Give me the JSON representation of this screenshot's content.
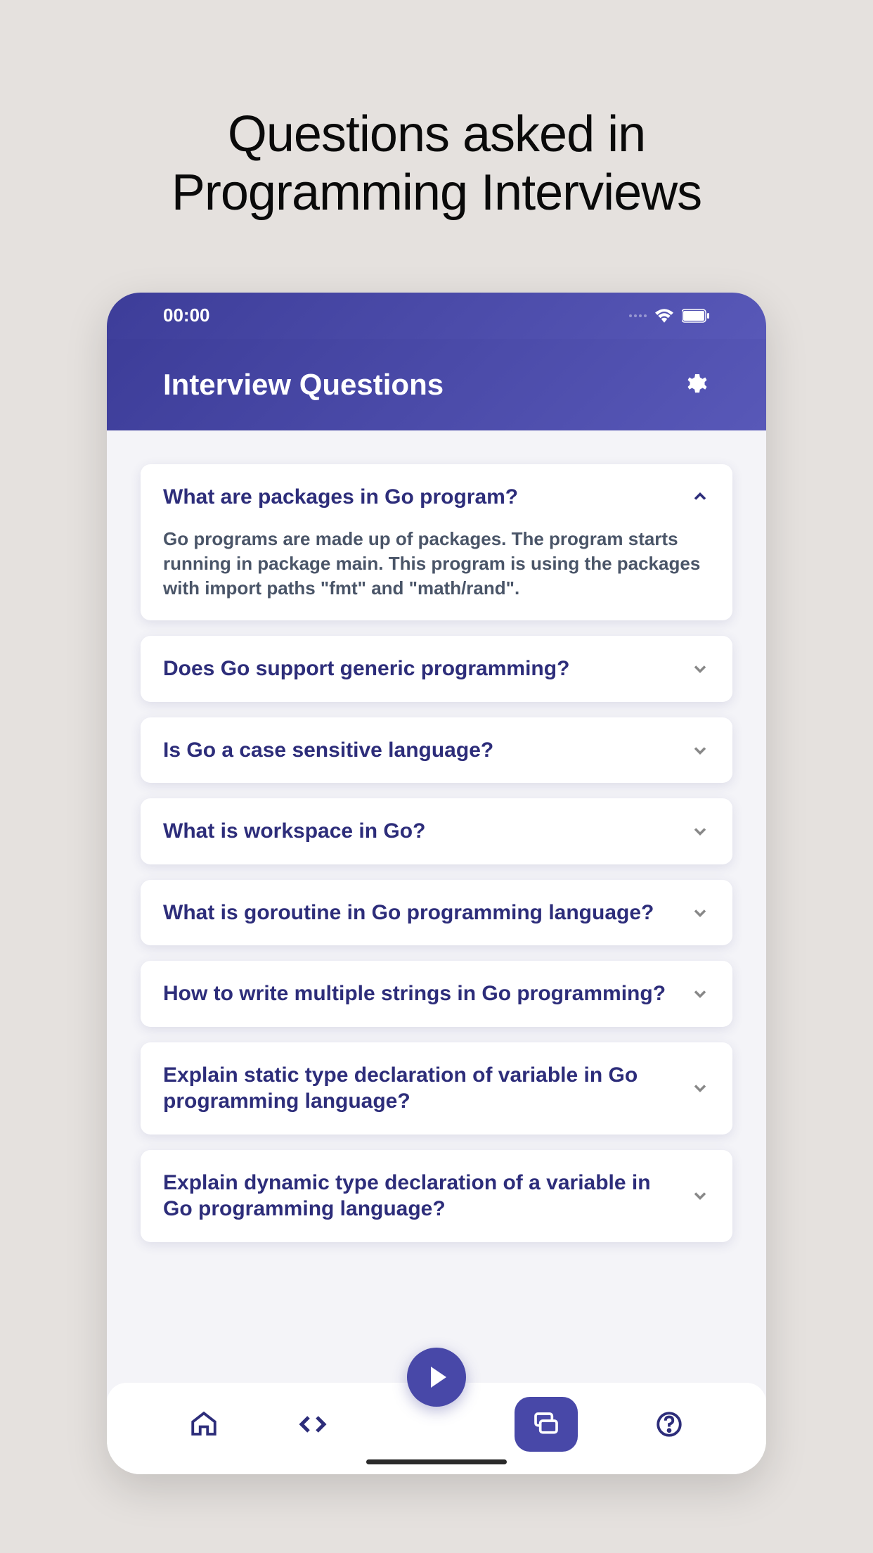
{
  "page": {
    "heading_line1": "Questions asked in",
    "heading_line2": "Programming Interviews"
  },
  "statusBar": {
    "time": "00:00"
  },
  "header": {
    "title": "Interview Questions"
  },
  "questions": [
    {
      "text": "What are packages in Go program?",
      "expanded": true,
      "answer": "Go programs are made up of packages. The program starts running in package main. This program is using the packages with import paths \"fmt\" and \"math/rand\"."
    },
    {
      "text": "Does Go support generic programming?",
      "expanded": false
    },
    {
      "text": "Is Go a case sensitive language?",
      "expanded": false
    },
    {
      "text": "What is workspace in Go?",
      "expanded": false
    },
    {
      "text": "What is goroutine in Go programming language?",
      "expanded": false
    },
    {
      "text": "How to write multiple strings in Go programming?",
      "expanded": false
    },
    {
      "text": "Explain static type declaration of variable in Go programming language?",
      "expanded": false
    },
    {
      "text": "Explain dynamic type declaration of a variable in Go programming language?",
      "expanded": false
    }
  ]
}
